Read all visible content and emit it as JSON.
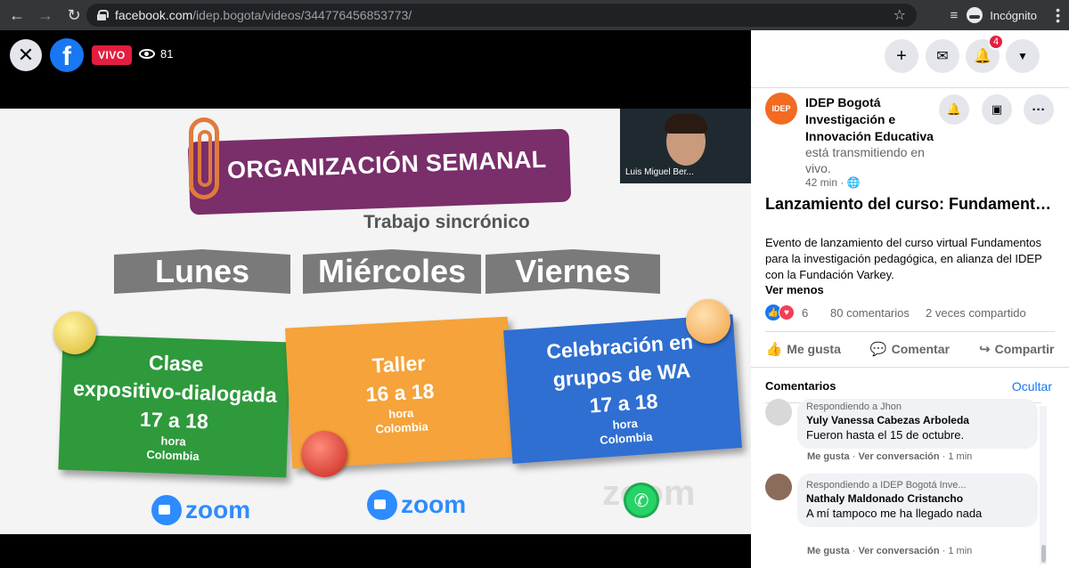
{
  "browser": {
    "url_host": "facebook.com",
    "url_path": "/idep.bogota/videos/344776456853773/",
    "incognito_label": "Incógnito"
  },
  "video": {
    "live_label": "VIVO",
    "viewers": "81",
    "slide": {
      "title": "ORGANIZACIÓN SEMANAL",
      "subtitle": "Trabajo sincrónico",
      "days": [
        "Lunes",
        "Miércoles",
        "Viernes"
      ],
      "cards": [
        {
          "line1": "Clase",
          "line2": "expositivo-dialogada",
          "time": "17 a 18",
          "unit1": "hora",
          "unit2": "Colombia",
          "color": "#2e9a3c"
        },
        {
          "line1": "Taller",
          "line2": "",
          "time": "16 a 18",
          "unit1": "hora",
          "unit2": "Colombia",
          "color": "#f5a33a"
        },
        {
          "line1": "Celebración en",
          "line2": "grupos de WA",
          "time": "17 a 18",
          "unit1": "hora",
          "unit2": "Colombia",
          "color": "#2f6fd1"
        }
      ],
      "zoom_label": "zoom",
      "zoom_faint": "zoom"
    },
    "pip_name": "Luis Miguel Ber..."
  },
  "panel": {
    "notifications_count": "4",
    "page_name": "IDEP Bogotá Investigación e Innovación Educativa",
    "page_avatar_text": "IDEP",
    "live_status": "está transmitiendo en vivo.",
    "time_ago": "42 min",
    "post_title": "Lanzamiento del curso: Fundamentos para la investigaci...",
    "post_desc": "Evento de lanzamiento del curso virtual Fundamentos para la investigación pedagógica, en alianza del IDEP con la Fundación Varkey.",
    "see_less": "Ver menos",
    "reactions_count": "6",
    "comments_count": "80 comentarios",
    "shares_count": "2 veces compartido",
    "actions": {
      "like": "Me gusta",
      "comment": "Comentar",
      "share": "Compartir"
    },
    "comments_header": "Comentarios",
    "hide_label": "Ocultar",
    "comments": [
      {
        "reply_to": "Respondiendo a Jhon",
        "author": "Yuly Vanessa Cabezas Arboleda",
        "text": "Fueron hasta el 15 de octubre.",
        "like": "Me gusta",
        "view": "Ver conversación",
        "time": "1 min"
      },
      {
        "reply_to": "Respondiendo a IDEP Bogotá Inve...",
        "author": "Nathaly Maldonado Cristancho",
        "text": "A mí tampoco me ha llegado nada",
        "like": "Me gusta",
        "view": "Ver conversación",
        "time": "1 min"
      }
    ]
  }
}
